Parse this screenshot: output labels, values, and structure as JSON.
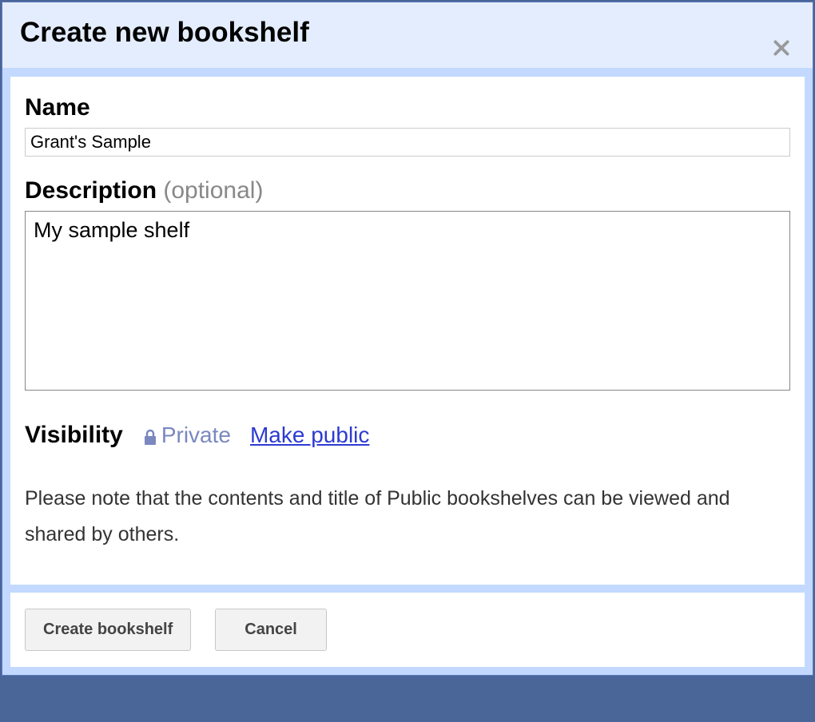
{
  "dialog": {
    "title": "Create new bookshelf"
  },
  "form": {
    "name_label": "Name",
    "name_value": "Grant's Sample",
    "description_label": "Description",
    "description_optional": " (optional)",
    "description_value": "My sample shelf",
    "visibility_label": "Visibility",
    "visibility_status": "Private",
    "make_public_label": "Make public",
    "visibility_note": "Please note that the contents and title of Public bookshelves can be viewed and shared by others."
  },
  "footer": {
    "create_label": "Create bookshelf",
    "cancel_label": "Cancel"
  }
}
